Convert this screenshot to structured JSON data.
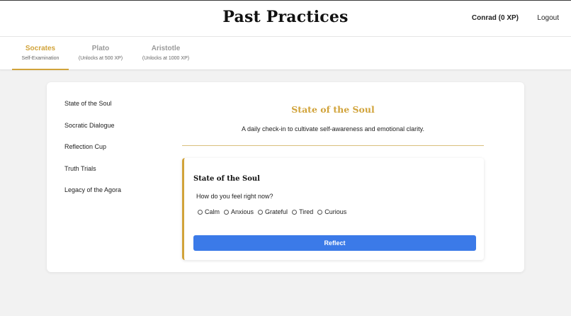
{
  "header": {
    "title": "Past Practices",
    "user": "Conrad (0 XP)",
    "logout_label": "Logout"
  },
  "tabs": [
    {
      "name": "Socrates",
      "sub": "Self-Examination",
      "active": true
    },
    {
      "name": "Plato",
      "sub": "(Unlocks at 500 XP)",
      "active": false
    },
    {
      "name": "Aristotle",
      "sub": "(Unlocks at 1000 XP)",
      "active": false
    }
  ],
  "sidebar": {
    "items": [
      {
        "label": "State of the Soul"
      },
      {
        "label": "Socratic Dialogue"
      },
      {
        "label": "Reflection Cup"
      },
      {
        "label": "Truth Trials"
      },
      {
        "label": "Legacy of the Agora"
      }
    ]
  },
  "main": {
    "title": "State of the Soul",
    "description": "A daily check-in to cultivate self-awareness and emotional clarity.",
    "panel": {
      "title": "State of the Soul",
      "question": "How do you feel right now?",
      "options": [
        "Calm",
        "Anxious",
        "Grateful",
        "Tired",
        "Curious"
      ],
      "button_label": "Reflect"
    }
  },
  "colors": {
    "accent_gold": "#d1a33a",
    "button_blue": "#3b7ae8"
  }
}
